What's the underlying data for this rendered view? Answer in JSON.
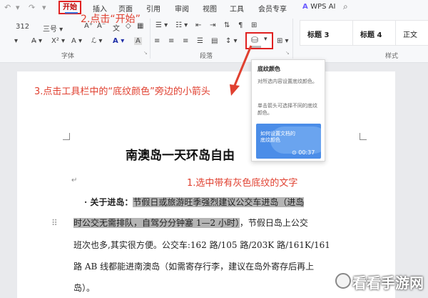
{
  "tabbar": {
    "tabs": [
      "开始",
      "插入",
      "页面",
      "引用",
      "审阅",
      "视图",
      "工具",
      "会员专享"
    ],
    "active_tab": "开始",
    "wps_ai": "WPS AI"
  },
  "annotations": {
    "step1": "1.选中带有灰色底纹的文字",
    "step2": "2.点击“开始”",
    "step3": "3.点击工具栏中的“底纹颜色”旁边的小箭头"
  },
  "ribbon": {
    "font_size": "312",
    "font_size_alt": "三号",
    "font_group": "字体",
    "para_group": "段落",
    "style_group": "样式",
    "styles": [
      "标题 3",
      "标题 4",
      "正文"
    ]
  },
  "tooltip": {
    "title": "底纹颜色",
    "desc1": "对所选内容设置底纹颜色。",
    "desc2": "单击箭头可选择不同的底纹颜色。",
    "video_caption": "如何设置文档的底纹颜色",
    "video_time": "00:37"
  },
  "document": {
    "title": "南澳岛一天环岛自由",
    "line1_label": "· 关于进岛：",
    "line1_hl": "节假日或旅游旺季强烈建议公交车进岛（进岛",
    "line2_hl": "时公交无需排队，自驾分分钟塞 1—2 小时）",
    "line2_rest": "，节假日岛上公交",
    "line3": "班次也多,其实很方便。公交车:162 路/105 路/203K 路/161K/161",
    "line4": "路 AB 线都能进南澳岛（如需寄存行李，建议在岛外寄存后再上",
    "line5": "岛）。"
  },
  "watermark": {
    "text": "看看手游网"
  },
  "colors": {
    "accent_red": "#e02020",
    "annotation_red": "#e04030",
    "highlight_gray": "#b4b4b4"
  }
}
